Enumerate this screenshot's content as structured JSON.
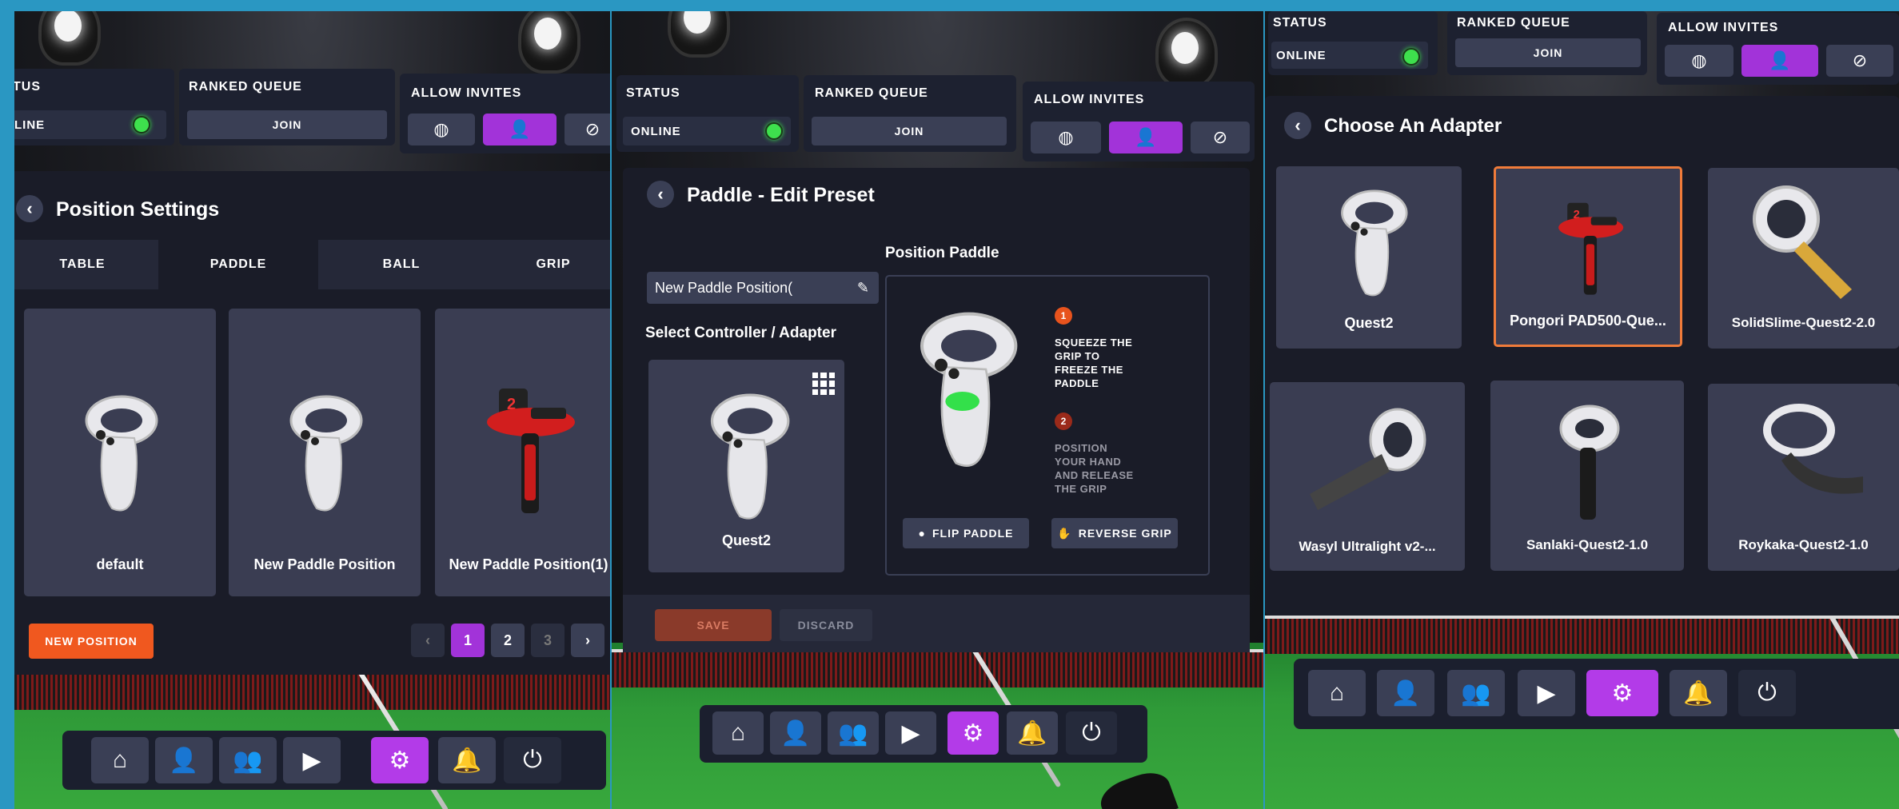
{
  "status_bar": {
    "status_label": "STATUS",
    "status_value": "ONLINE",
    "ranked_queue_label": "RANKED QUEUE",
    "join_label": "JOIN",
    "allow_invites_label": "ALLOW INVITES",
    "status_color": "#3ee04d"
  },
  "panel1": {
    "status_label": "TUS",
    "status_value": "LINE",
    "title": "Position Settings",
    "tabs": [
      {
        "label": "TABLE"
      },
      {
        "label": "PADDLE"
      },
      {
        "label": "BALL"
      },
      {
        "label": "GRIP"
      }
    ],
    "positions": [
      {
        "label": "default",
        "icon": "quest2-controller-icon"
      },
      {
        "label": "New Paddle Position",
        "icon": "quest2-controller-icon"
      },
      {
        "label": "New Paddle Position(1)",
        "icon": "paddle-adapter-icon"
      }
    ],
    "new_position_label": "NEW POSITION",
    "pages": [
      "1",
      "2",
      "3"
    ],
    "current_page": "1"
  },
  "panel2": {
    "title": "Paddle - Edit Preset",
    "preset_name": "New Paddle Position(",
    "select_controller_label": "Select Controller / Adapter",
    "controller_name": "Quest2",
    "position_paddle_label": "Position Paddle",
    "steps": [
      {
        "num": "1",
        "text": "SQUEEZE THE GRIP TO FREEZE THE PADDLE"
      },
      {
        "num": "2",
        "text": "POSITION YOUR HAND AND RELEASE THE GRIP"
      }
    ],
    "flip_paddle_label": "FLIP PADDLE",
    "reverse_grip_label": "REVERSE GRIP",
    "save_label": "SAVE",
    "discard_label": "DISCARD"
  },
  "panel3": {
    "title": "Choose An Adapter",
    "adapters": [
      {
        "label": "Quest2",
        "selected": false
      },
      {
        "label": "Pongori PAD500-Que...",
        "selected": true
      },
      {
        "label": "SolidSlime-Quest2-2.0",
        "selected": false
      },
      {
        "label": "Wasyl Ultralight v2-...",
        "selected": false
      },
      {
        "label": "Sanlaki-Quest2-1.0",
        "selected": false
      },
      {
        "label": "Roykaka-Quest2-1.0",
        "selected": false
      }
    ]
  },
  "nav_icons": [
    "home-icon",
    "profile-icon",
    "friends-icon",
    "replay-icon",
    "settings-icon",
    "notifications-icon",
    "power-icon"
  ],
  "colors": {
    "accent": "#a233d9",
    "orange": "#f0581f",
    "panel_bg": "#1a1c28",
    "card_bg": "#3a3d52"
  }
}
